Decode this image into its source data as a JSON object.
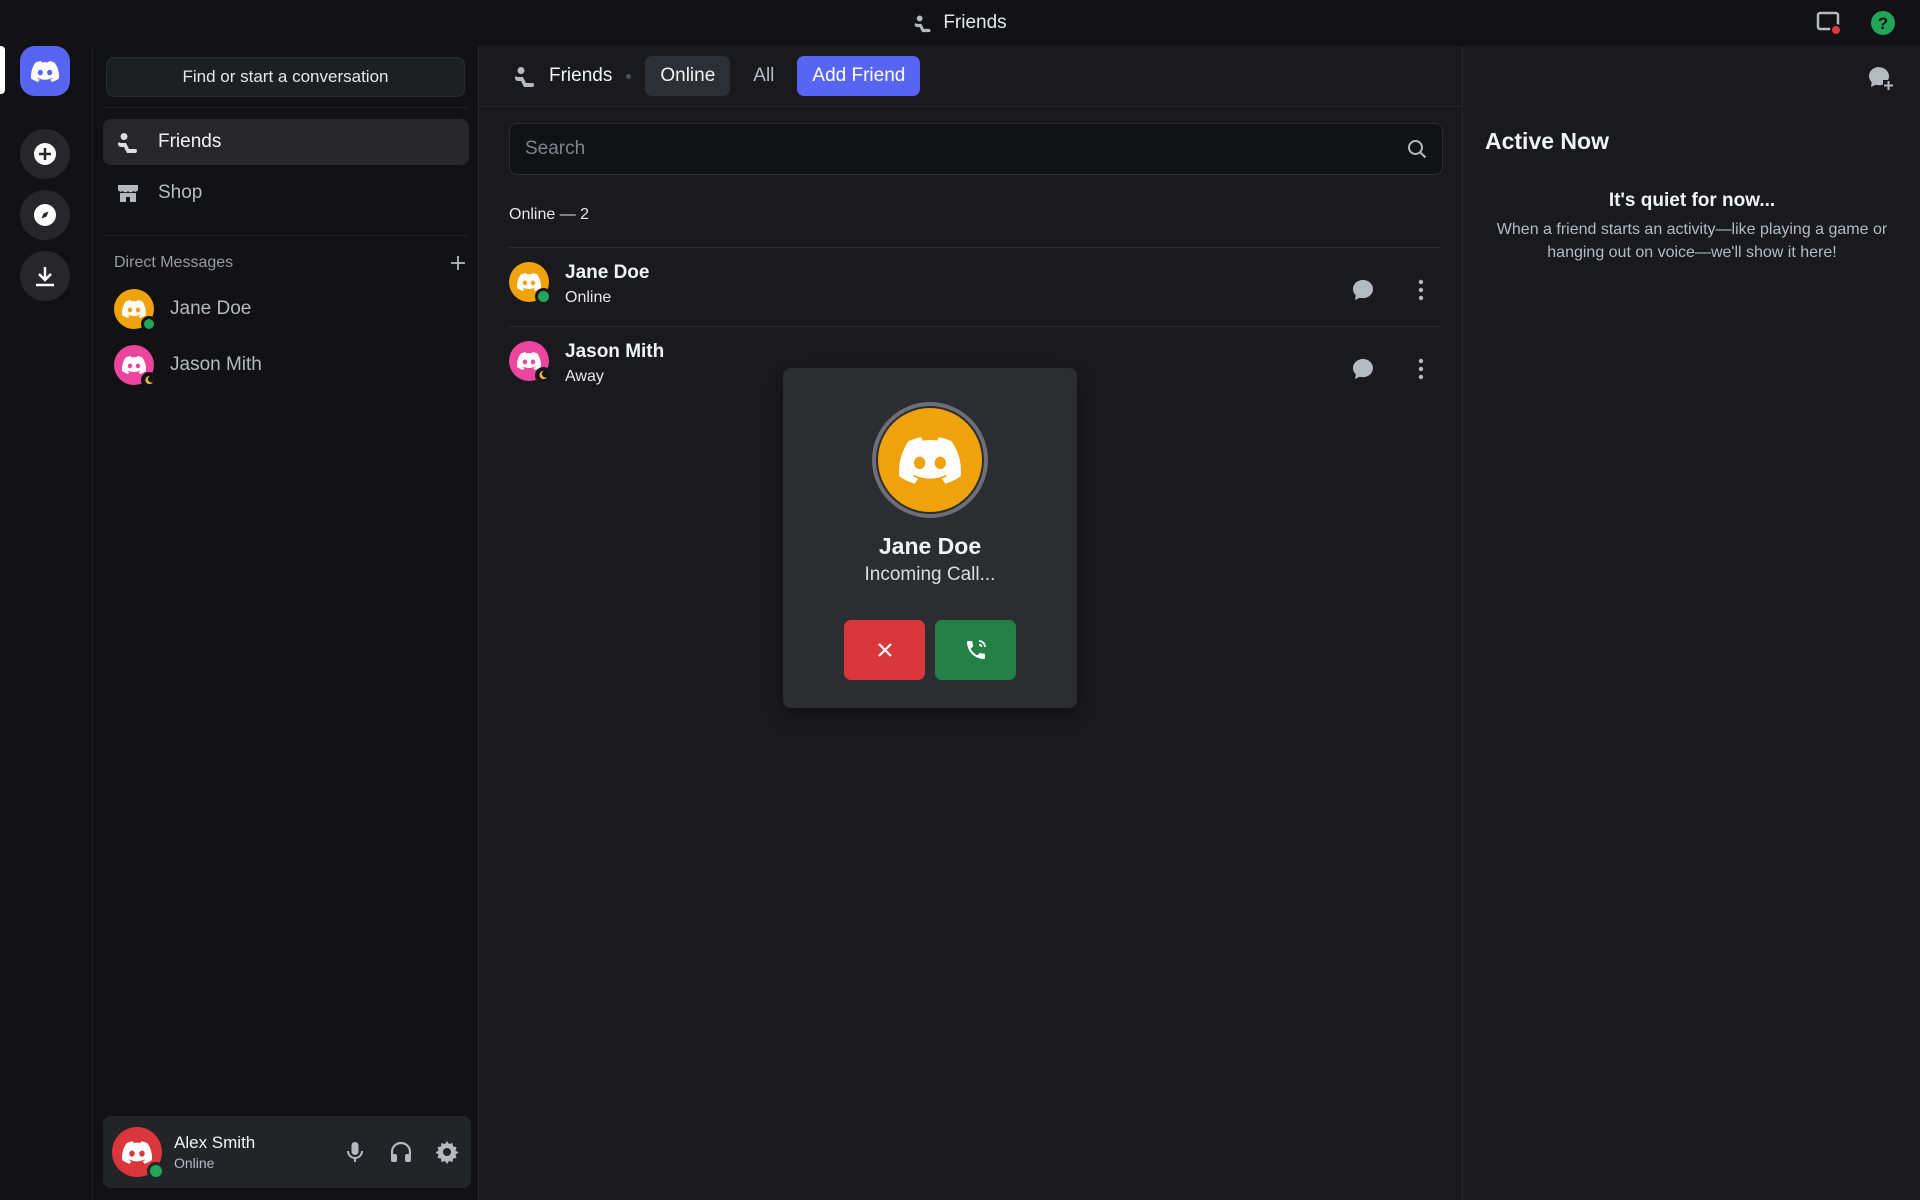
{
  "window": {
    "title": "Friends"
  },
  "sidebar": {
    "find_placeholder": "Find or start a conversation",
    "nav": [
      {
        "label": "Friends",
        "icon": "friends-icon",
        "active": true
      },
      {
        "label": "Shop",
        "icon": "shop-icon",
        "active": false
      }
    ],
    "dm_header": "Direct Messages",
    "dms": [
      {
        "name": "Jane Doe",
        "status": "online",
        "avatar_color": "#f0a20b"
      },
      {
        "name": "Jason Mith",
        "status": "away",
        "avatar_color": "#eb459e"
      }
    ]
  },
  "user_panel": {
    "name": "Alex Smith",
    "status": "Online",
    "avatar_color": "#da373c"
  },
  "header": {
    "title": "Friends",
    "tabs": [
      {
        "label": "Online",
        "active": true
      },
      {
        "label": "All",
        "active": false
      },
      {
        "label": "Add Friend",
        "primary": true
      }
    ]
  },
  "search": {
    "placeholder": "Search"
  },
  "friends": {
    "section_label": "Online — 2",
    "rows": [
      {
        "name": "Jane Doe",
        "status": "Online",
        "avatar_color": "#f0a20b"
      },
      {
        "name": "Jason Mith",
        "status": "Away",
        "avatar_color": "#eb459e"
      }
    ]
  },
  "call": {
    "name": "Jane Doe",
    "status": "Incoming Call..."
  },
  "active_now": {
    "title": "Active Now",
    "quiet": "It's quiet for now...",
    "description": "When a friend starts an activity—like playing a game or hanging out on voice—we'll show it here!"
  },
  "colors": {
    "accent": "#5865f2",
    "online": "#23a559",
    "away": "#f0b232",
    "decline": "#da373c",
    "accept": "#248046"
  }
}
